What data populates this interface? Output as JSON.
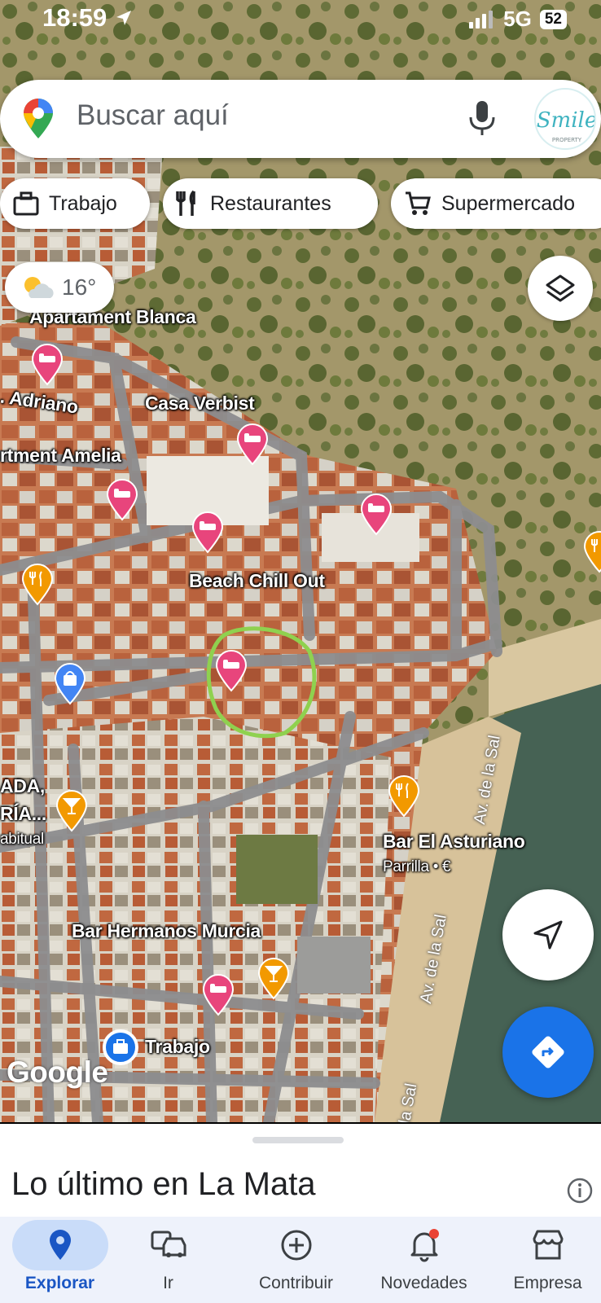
{
  "status_bar": {
    "time": "18:59",
    "network": "5G",
    "battery": "52"
  },
  "search": {
    "placeholder": "Buscar aquí"
  },
  "chips": [
    {
      "label": "Trabajo",
      "icon": "briefcase-icon"
    },
    {
      "label": "Restaurantes",
      "icon": "fork-knife-icon"
    },
    {
      "label": "Supermercado",
      "icon": "cart-icon"
    }
  ],
  "weather": {
    "temperature": "16°",
    "icon": "partly-cloudy-icon"
  },
  "map_labels": {
    "apartament_blanca": "Apartament Blanca",
    "adriano": ". Adriano",
    "casa_verbist": "Casa Verbist",
    "apartment_amelia": "rtment Amelia",
    "beach_chill_out": "Beach Chill Out",
    "ada": "ADA,",
    "ria": "RÍA...",
    "abitual": "abitual",
    "bar_el_asturiano": "Bar El Asturiano",
    "parrilla": "Parrilla • €",
    "bar_hermanos_murcia": "Bar Hermanos Murcia",
    "trabajo_pin": "Trabajo",
    "google": "Google"
  },
  "street_labels": {
    "av_de_la_sal_1": "Av. de la Sal",
    "av_de_la_sal_2": "Av. de la Sal",
    "la_sal": "la Sal"
  },
  "colors": {
    "hotel_pin": "#e8457c",
    "food_pin": "#f29900",
    "shop_pin": "#4285f4",
    "highlight_circle": "#8fd14f",
    "primary_blue": "#1a73e8"
  },
  "sheet": {
    "title": "Lo último en La Mata"
  },
  "nav": [
    {
      "label": "Explorar",
      "icon": "location-pin-icon",
      "active": true
    },
    {
      "label": "Ir",
      "icon": "car-icon",
      "active": false
    },
    {
      "label": "Contribuir",
      "icon": "add-circle-icon",
      "active": false
    },
    {
      "label": "Novedades",
      "icon": "bell-icon",
      "active": false
    },
    {
      "label": "Empresa",
      "icon": "storefront-icon",
      "active": false
    }
  ]
}
